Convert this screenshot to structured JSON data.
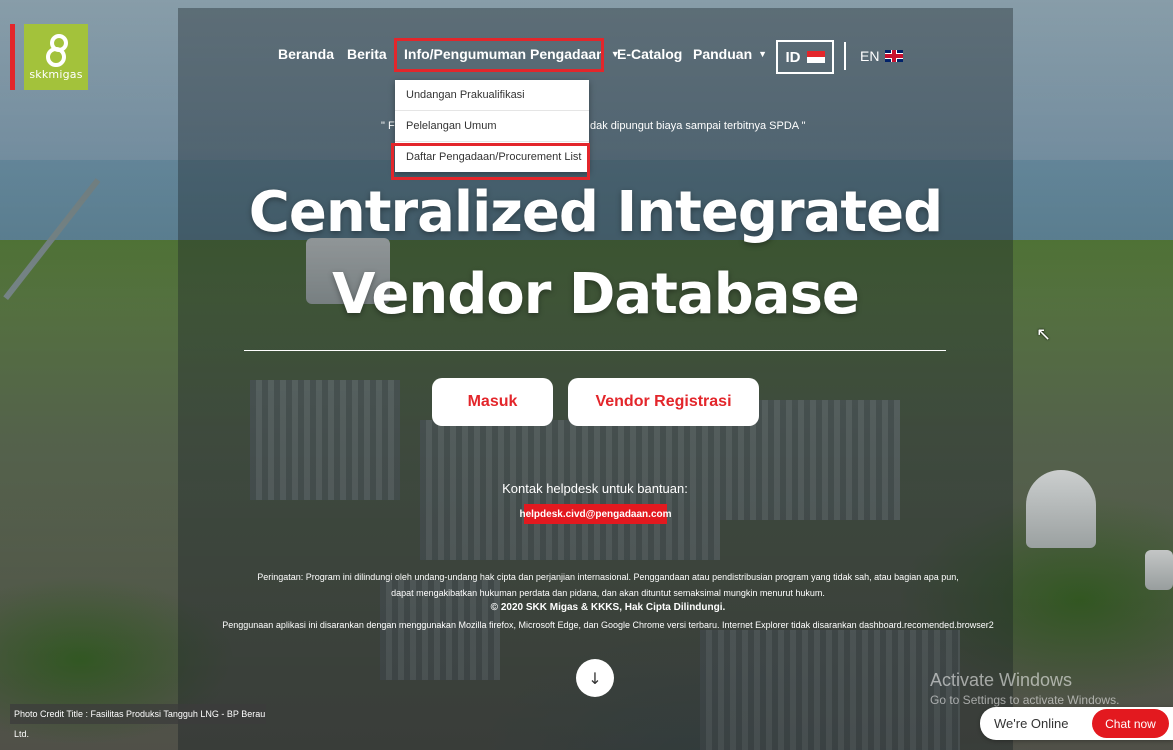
{
  "brand": {
    "logo_text": "skkmigas",
    "colors": {
      "accent": "#e3262b",
      "logo_green": "#a3c23b"
    }
  },
  "nav": {
    "items": [
      {
        "label": "Beranda"
      },
      {
        "label": "Berita"
      },
      {
        "label": "Info/Pengumuman Pengadaan"
      },
      {
        "label": "E-Catalog"
      },
      {
        "label": "Panduan"
      }
    ],
    "lang_id": "ID",
    "lang_en": "EN"
  },
  "dropdown": {
    "items": [
      {
        "label": "Undangan Prakualifikasi"
      },
      {
        "label": "Pelelangan Umum"
      },
      {
        "label": "Daftar Pengadaan/Procurement List"
      }
    ]
  },
  "hero": {
    "notice_start": "\" F",
    "notice_end": "dak dipungut biaya sampai terbitnya SPDA \"",
    "title_line1": "Centralized Integrated",
    "title_line2": "Vendor Database",
    "masuk_label": "Masuk",
    "register_label": "Vendor Registrasi"
  },
  "help": {
    "label": "Kontak helpdesk untuk bantuan:",
    "email": "helpdesk.civd@pengadaan.com"
  },
  "legal": {
    "line1": "Peringatan: Program ini dilindungi oleh undang-undang hak cipta dan perjanjian internasional. Penggandaan atau pendistribusian program yang tidak sah, atau bagian apa pun,",
    "line2": "dapat mengakibatkan hukuman perdata dan pidana, dan akan dituntut semaksimal mungkin menurut hukum.",
    "copyright": "© 2020 SKK Migas & KKKS, Hak Cipta Dilindungi.",
    "browser_note": "Penggunaan aplikasi ini disarankan dengan menggunakan Mozilla firefox, Microsoft Edge, dan Google Chrome versi terbaru. Internet Explorer tidak disarankan dashboard.recomended.browser2"
  },
  "photo_credit": "Photo Credit Title : Fasilitas Produksi Tangguh LNG - BP Berau Ltd.",
  "watermark": {
    "line1": "Activate Windows",
    "line2": "Go to Settings to activate Windows."
  },
  "chat": {
    "status": "We're Online",
    "button": "Chat now"
  },
  "icons": {
    "scroll": "arrow-down-icon",
    "dropdown_caret": "chevron-down-icon",
    "flag_id": "flag-id-icon",
    "flag_en": "flag-uk-icon"
  }
}
